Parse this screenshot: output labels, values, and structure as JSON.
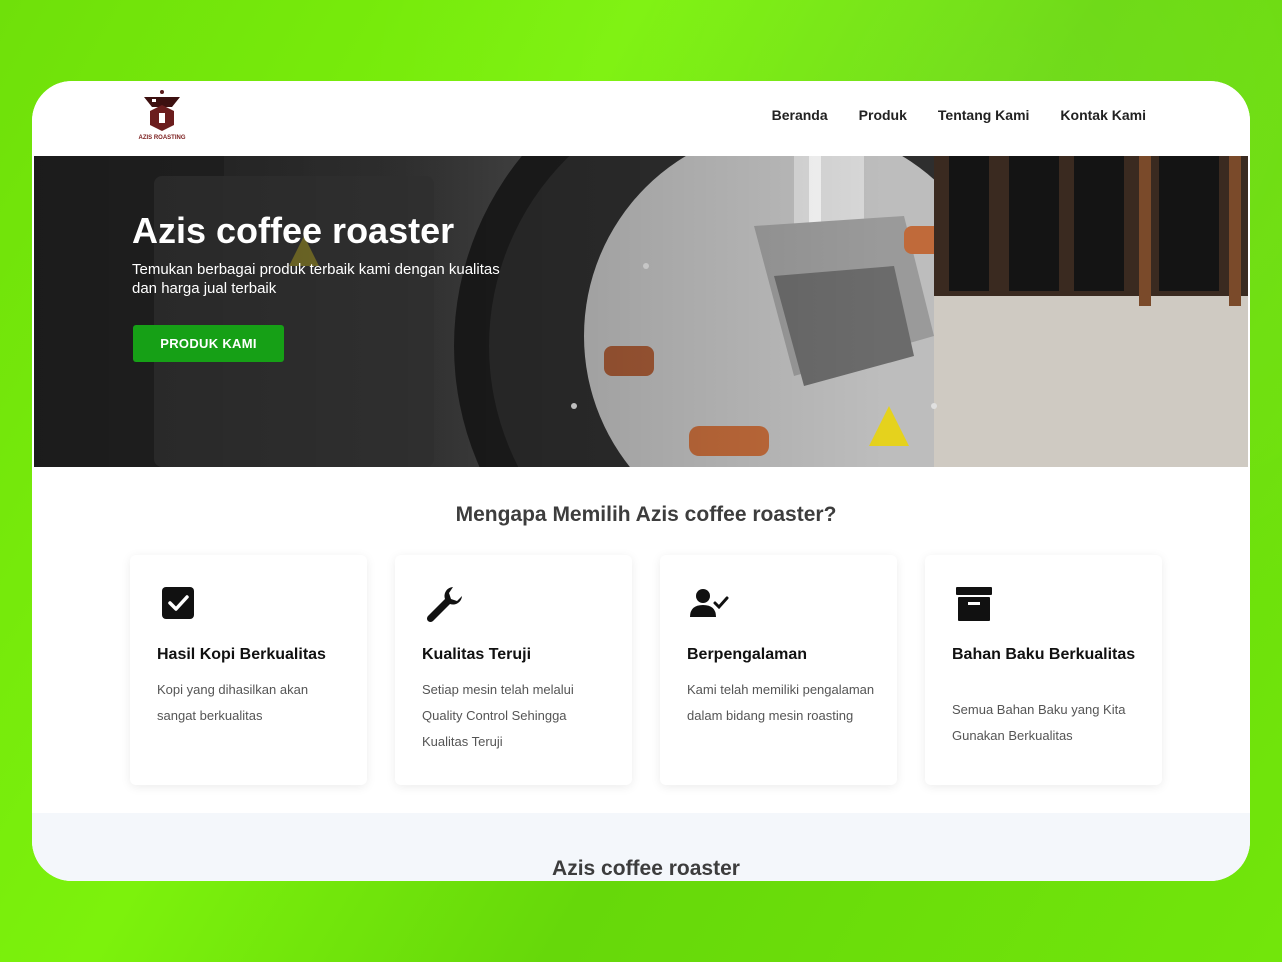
{
  "brand": {
    "logo_text": "AZIS ROASTING"
  },
  "nav": {
    "items": [
      "Beranda",
      "Produk",
      "Tentang Kami",
      "Kontak Kami"
    ]
  },
  "hero": {
    "title": "Azis coffee roaster",
    "subtitle": "Temukan berbagai produk terbaik kami dengan kualitas dan harga jual terbaik",
    "button": "PRODUK KAMI"
  },
  "why": {
    "title": "Mengapa Memilih Azis coffee roaster?",
    "cards": [
      {
        "icon": "checkbox-icon",
        "title": "Hasil Kopi Berkualitas",
        "text": "Kopi yang dihasilkan akan sangat berkualitas"
      },
      {
        "icon": "wrench-icon",
        "title": "Kualitas Teruji",
        "text": "Setiap mesin telah melalui Quality Control Sehingga Kualitas Teruji"
      },
      {
        "icon": "user-check-icon",
        "title": "Berpengalaman",
        "text": "Kami telah memiliki pengalaman dalam bidang mesin roasting"
      },
      {
        "icon": "archive-box-icon",
        "title": "Bahan Baku Berkualitas",
        "text": "Semua Bahan Baku yang Kita Gunakan Berkualitas"
      }
    ]
  },
  "footer": {
    "title": "Azis coffee roaster"
  },
  "colors": {
    "accent": "#16a016",
    "background": "#74e80b"
  }
}
